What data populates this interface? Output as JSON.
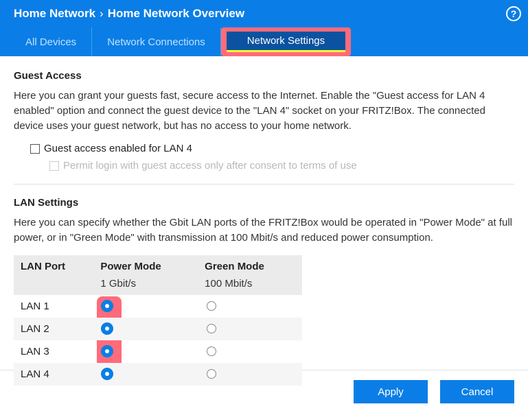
{
  "breadcrumb": {
    "root": "Home Network",
    "leaf": "Home Network Overview"
  },
  "tabs": {
    "all_devices": "All Devices",
    "network_connections": "Network Connections",
    "network_settings": "Network Settings"
  },
  "guest_access": {
    "title": "Guest Access",
    "desc": "Here you can grant your guests fast, secure access to the Internet. Enable the \"Guest access for LAN 4 enabled\" option and connect the guest device to the \"LAN 4\" socket on your FRITZ!Box. The connected device uses your guest network, but has no access to your home network.",
    "cb1_label": "Guest access enabled for LAN 4",
    "cb2_label": "Permit login with guest access only after consent to terms of use"
  },
  "lan_settings": {
    "title": "LAN Settings",
    "desc": "Here you can specify whether the Gbit LAN ports of the FRITZ!Box would be operated in \"Power Mode\" at full power, or in \"Green Mode\" with transmission at 100 Mbit/s and reduced power consumption.",
    "columns": {
      "port": "LAN Port",
      "power": "Power Mode",
      "green": "Green Mode"
    },
    "subheaders": {
      "power": "1 Gbit/s",
      "green": "100 Mbit/s"
    },
    "rows": [
      {
        "name": "LAN 1",
        "mode": "power"
      },
      {
        "name": "LAN 2",
        "mode": "power"
      },
      {
        "name": "LAN 3",
        "mode": "power"
      },
      {
        "name": "LAN 4",
        "mode": "power"
      }
    ]
  },
  "buttons": {
    "apply": "Apply",
    "cancel": "Cancel"
  },
  "help_glyph": "?"
}
